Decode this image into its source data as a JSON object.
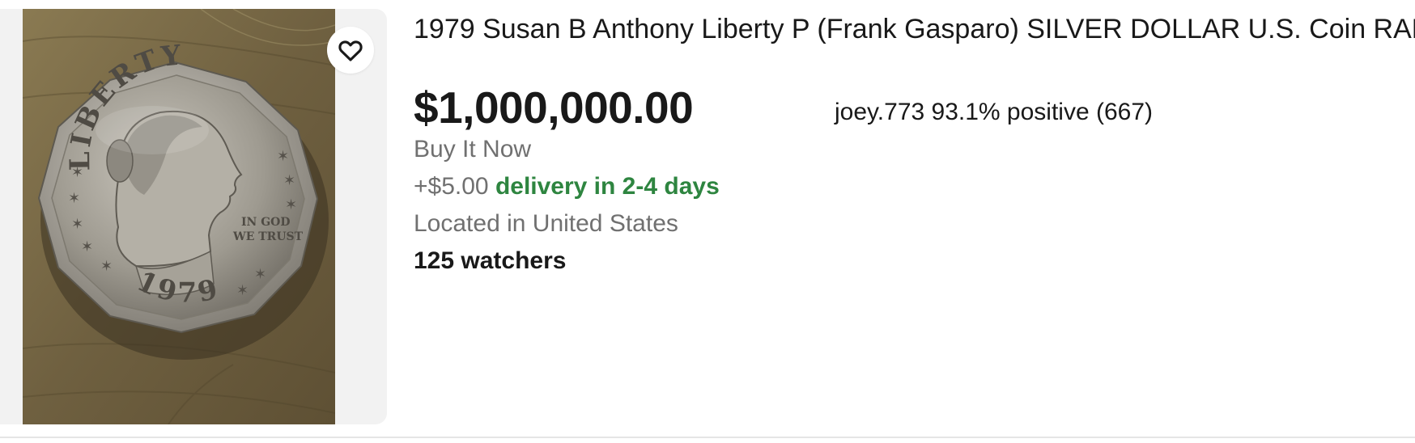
{
  "listing": {
    "title": "1979 Susan B Anthony Liberty P (Frank Gasparo) SILVER DOLLAR U.S. Coin RARE!",
    "price": "$1,000,000.00",
    "format": "Buy It Now",
    "shipping_cost": "+$5.00",
    "delivery": "delivery in 2-4 days",
    "location": "Located in United States",
    "watchers": "125 watchers",
    "seller": "joey.773 93.1% positive (667)",
    "watch_icon": "heart-outline-icon",
    "coin_legend": "LIBERTY",
    "coin_year": "1979",
    "coin_motto_1": "IN GOD",
    "coin_motto_2": "WE TRUST"
  },
  "colors": {
    "text": "#191919",
    "secondary_text": "#707070",
    "delivery_green": "#2e8540",
    "image_panel_bg": "#f2f2f2"
  }
}
